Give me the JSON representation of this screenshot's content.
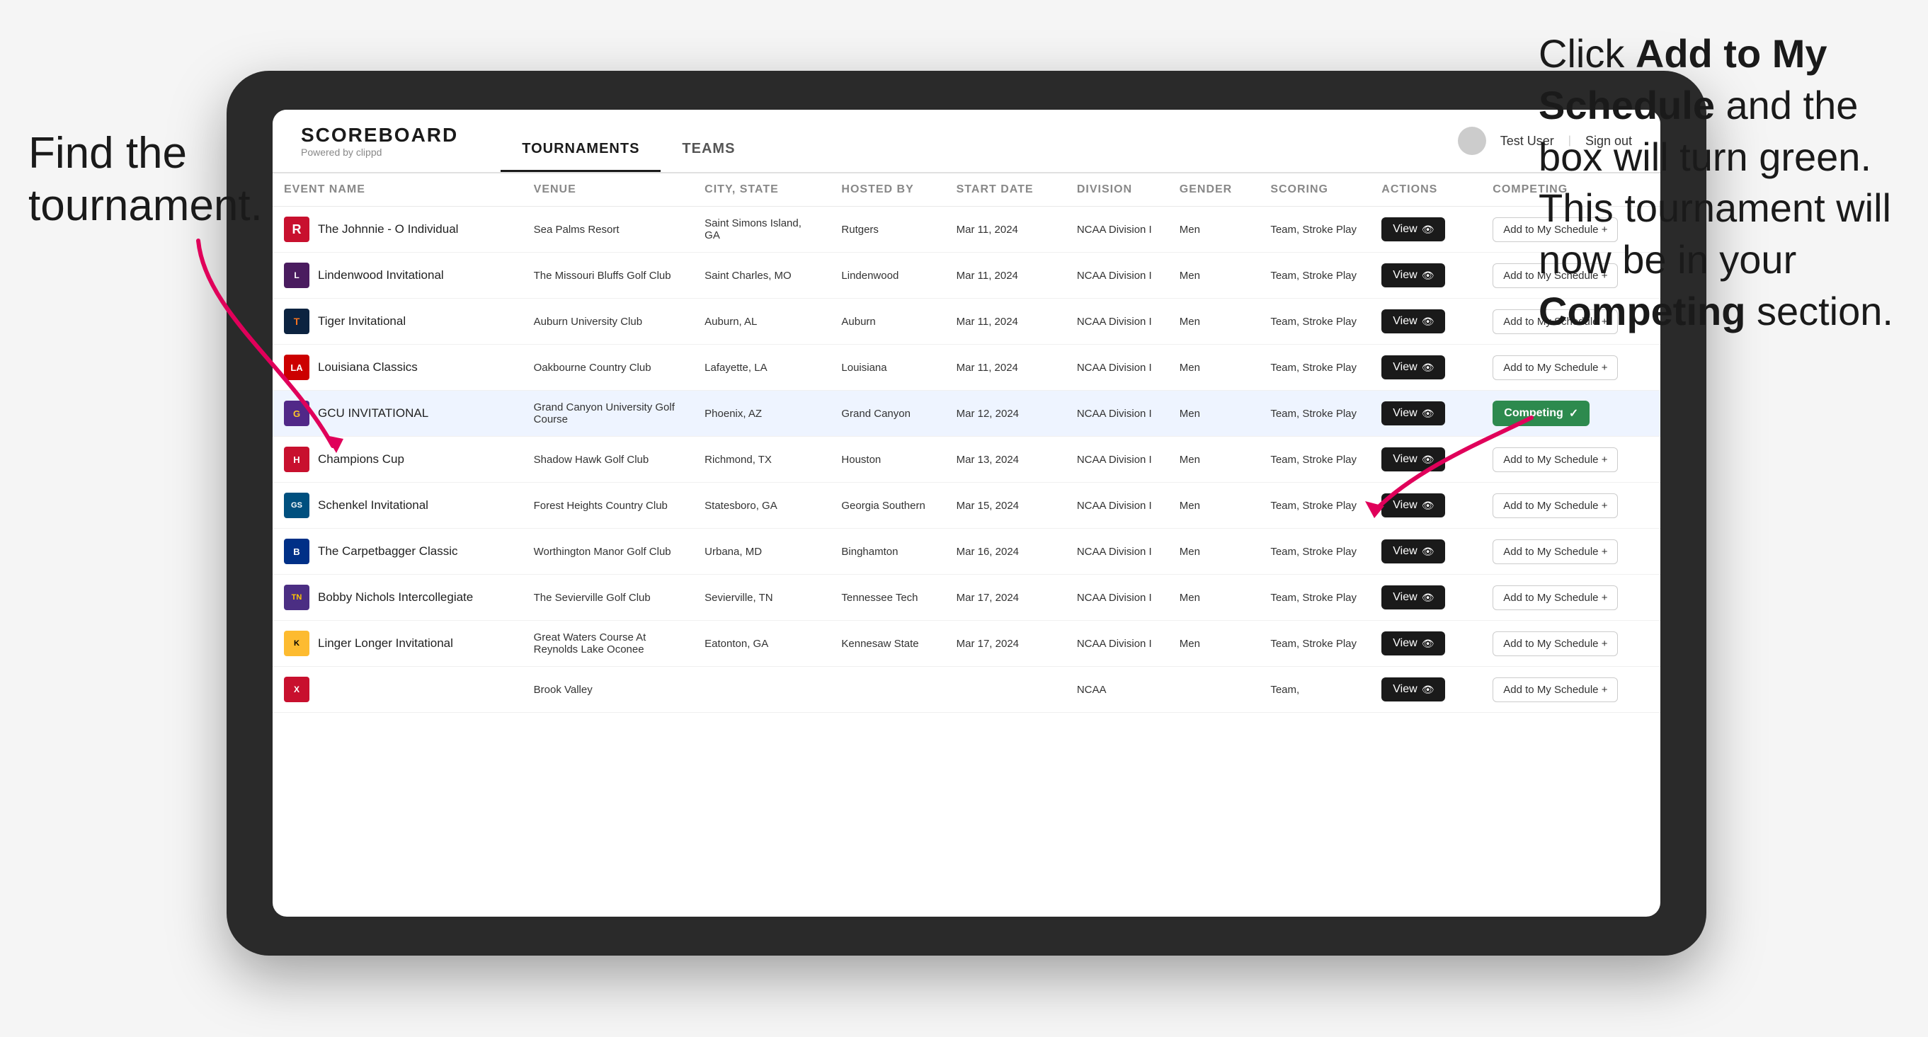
{
  "instruction_left": "Find the tournament.",
  "instruction_right_part1": "Click ",
  "instruction_right_bold1": "Add to My Schedule",
  "instruction_right_part2": " and the box will turn green. This tournament will now be in your ",
  "instruction_right_bold2": "Competing",
  "instruction_right_part3": " section.",
  "app": {
    "logo": "SCOREBOARD",
    "logo_sub": "Powered by clippd",
    "nav": [
      "TOURNAMENTS",
      "TEAMS"
    ],
    "active_nav": 0,
    "user": "Test User",
    "sign_out": "Sign out"
  },
  "table": {
    "columns": [
      "EVENT NAME",
      "VENUE",
      "CITY, STATE",
      "HOSTED BY",
      "START DATE",
      "DIVISION",
      "GENDER",
      "SCORING",
      "ACTIONS",
      "COMPETING"
    ],
    "rows": [
      {
        "logo": "R",
        "logo_class": "logo-r",
        "event": "The Johnnie - O Individual",
        "venue": "Sea Palms Resort",
        "city": "Saint Simons Island, GA",
        "hosted": "Rutgers",
        "date": "Mar 11, 2024",
        "division": "NCAA Division I",
        "gender": "Men",
        "scoring": "Team, Stroke Play",
        "status": "add",
        "btn_label": "Add to My Schedule +"
      },
      {
        "logo": "L",
        "logo_class": "logo-l",
        "event": "Lindenwood Invitational",
        "venue": "The Missouri Bluffs Golf Club",
        "city": "Saint Charles, MO",
        "hosted": "Lindenwood",
        "date": "Mar 11, 2024",
        "division": "NCAA Division I",
        "gender": "Men",
        "scoring": "Team, Stroke Play",
        "status": "add",
        "btn_label": "Add to My Schedule +"
      },
      {
        "logo": "T",
        "logo_class": "logo-t",
        "event": "Tiger Invitational",
        "venue": "Auburn University Club",
        "city": "Auburn, AL",
        "hosted": "Auburn",
        "date": "Mar 11, 2024",
        "division": "NCAA Division I",
        "gender": "Men",
        "scoring": "Team, Stroke Play",
        "status": "add",
        "btn_label": "Add to My Schedule +"
      },
      {
        "logo": "LA",
        "logo_class": "logo-la",
        "event": "Louisiana Classics",
        "venue": "Oakbourne Country Club",
        "city": "Lafayette, LA",
        "hosted": "Louisiana",
        "date": "Mar 11, 2024",
        "division": "NCAA Division I",
        "gender": "Men",
        "scoring": "Team, Stroke Play",
        "status": "add",
        "btn_label": "Add to My Schedule +"
      },
      {
        "logo": "G",
        "logo_class": "logo-g",
        "event": "GCU INVITATIONAL",
        "venue": "Grand Canyon University Golf Course",
        "city": "Phoenix, AZ",
        "hosted": "Grand Canyon",
        "date": "Mar 12, 2024",
        "division": "NCAA Division I",
        "gender": "Men",
        "scoring": "Team, Stroke Play",
        "status": "competing",
        "btn_label": "Competing ✓",
        "highlighted": true
      },
      {
        "logo": "H",
        "logo_class": "logo-h",
        "event": "Champions Cup",
        "venue": "Shadow Hawk Golf Club",
        "city": "Richmond, TX",
        "hosted": "Houston",
        "date": "Mar 13, 2024",
        "division": "NCAA Division I",
        "gender": "Men",
        "scoring": "Team, Stroke Play",
        "status": "add",
        "btn_label": "Add to My Schedule +"
      },
      {
        "logo": "GS",
        "logo_class": "logo-gs",
        "event": "Schenkel Invitational",
        "venue": "Forest Heights Country Club",
        "city": "Statesboro, GA",
        "hosted": "Georgia Southern",
        "date": "Mar 15, 2024",
        "division": "NCAA Division I",
        "gender": "Men",
        "scoring": "Team, Stroke Play",
        "status": "add",
        "btn_label": "Add to My Schedule +"
      },
      {
        "logo": "B",
        "logo_class": "logo-b",
        "event": "The Carpetbagger Classic",
        "venue": "Worthington Manor Golf Club",
        "city": "Urbana, MD",
        "hosted": "Binghamton",
        "date": "Mar 16, 2024",
        "division": "NCAA Division I",
        "gender": "Men",
        "scoring": "Team, Stroke Play",
        "status": "add",
        "btn_label": "Add to My Schedule +"
      },
      {
        "logo": "TN",
        "logo_class": "logo-tn",
        "event": "Bobby Nichols Intercollegiate",
        "venue": "The Sevierville Golf Club",
        "city": "Sevierville, TN",
        "hosted": "Tennessee Tech",
        "date": "Mar 17, 2024",
        "division": "NCAA Division I",
        "gender": "Men",
        "scoring": "Team, Stroke Play",
        "status": "add",
        "btn_label": "Add to My Schedule +"
      },
      {
        "logo": "K",
        "logo_class": "logo-k",
        "event": "Linger Longer Invitational",
        "venue": "Great Waters Course At Reynolds Lake Oconee",
        "city": "Eatonton, GA",
        "hosted": "Kennesaw State",
        "date": "Mar 17, 2024",
        "division": "NCAA Division I",
        "gender": "Men",
        "scoring": "Team, Stroke Play",
        "status": "add",
        "btn_label": "Add to My Schedule +"
      },
      {
        "logo": "X",
        "logo_class": "logo-x",
        "event": "",
        "venue": "Brook Valley",
        "city": "",
        "hosted": "",
        "date": "",
        "division": "NCAA",
        "gender": "",
        "scoring": "Team,",
        "status": "add",
        "btn_label": "Add to My Schedule +"
      }
    ]
  }
}
